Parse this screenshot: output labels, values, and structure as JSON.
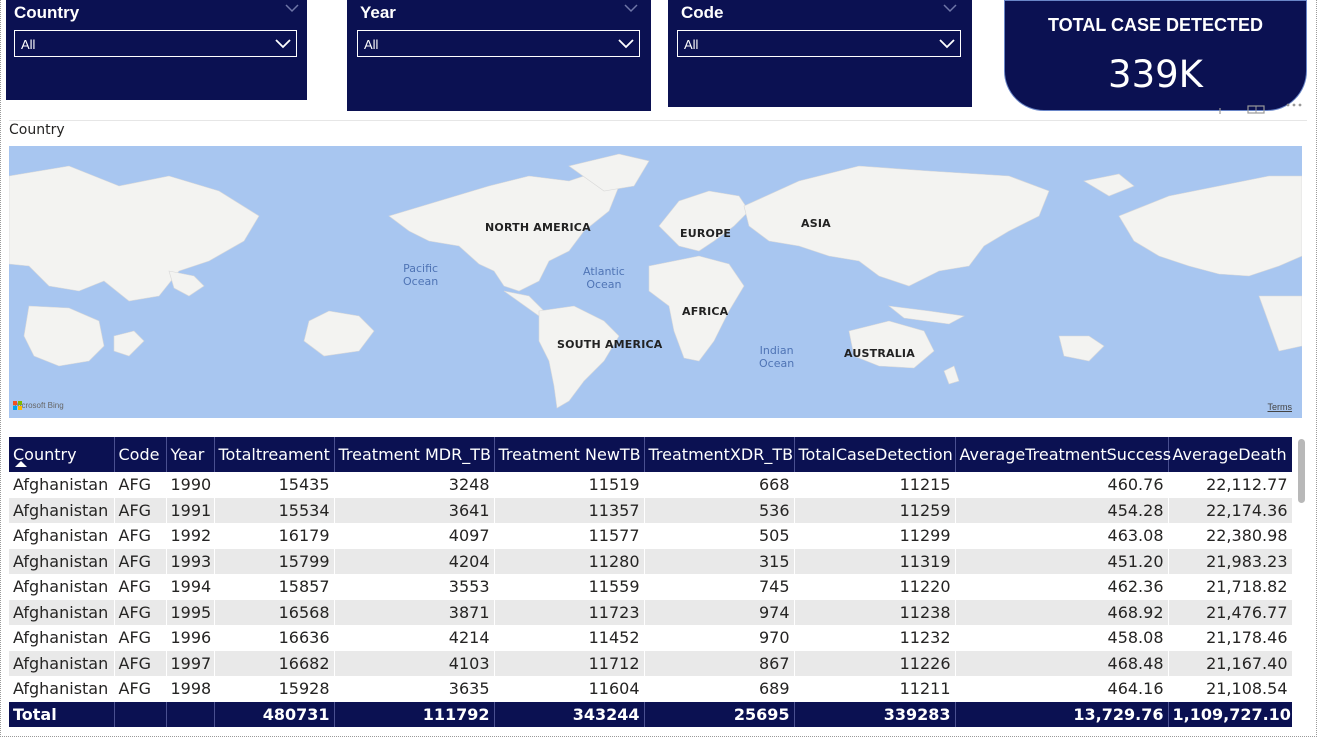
{
  "slicers": [
    {
      "title": "Country",
      "value": "All"
    },
    {
      "title": "Year",
      "value": "All"
    },
    {
      "title": "Code",
      "value": "All"
    }
  ],
  "kpi": {
    "title": "TOTAL CASE DETECTED",
    "value": "339K"
  },
  "map": {
    "title": "Country",
    "continents": [
      "NORTH AMERICA",
      "EUROPE",
      "ASIA",
      "AFRICA",
      "SOUTH AMERICA",
      "AUSTRALIA"
    ],
    "oceans": [
      "Pacific\nOcean",
      "Atlantic\nOcean",
      "Indian\nOcean"
    ],
    "attribution": "Microsoft Bing",
    "terms": "Terms"
  },
  "table": {
    "columns": [
      "Country",
      "Code",
      "Year",
      "Totaltreament",
      "Treatment MDR_TB",
      "Treatment NewTB",
      "TreatmentXDR_TB",
      "TotalCaseDetection",
      "AverageTreatmentSuccess",
      "AverageDeath"
    ],
    "rows": [
      [
        "Afghanistan",
        "AFG",
        "1990",
        "15435",
        "3248",
        "11519",
        "668",
        "11215",
        "460.76",
        "22,112.77"
      ],
      [
        "Afghanistan",
        "AFG",
        "1991",
        "15534",
        "3641",
        "11357",
        "536",
        "11259",
        "454.28",
        "22,174.36"
      ],
      [
        "Afghanistan",
        "AFG",
        "1992",
        "16179",
        "4097",
        "11577",
        "505",
        "11299",
        "463.08",
        "22,380.98"
      ],
      [
        "Afghanistan",
        "AFG",
        "1993",
        "15799",
        "4204",
        "11280",
        "315",
        "11319",
        "451.20",
        "21,983.23"
      ],
      [
        "Afghanistan",
        "AFG",
        "1994",
        "15857",
        "3553",
        "11559",
        "745",
        "11220",
        "462.36",
        "21,718.82"
      ],
      [
        "Afghanistan",
        "AFG",
        "1995",
        "16568",
        "3871",
        "11723",
        "974",
        "11238",
        "468.92",
        "21,476.77"
      ],
      [
        "Afghanistan",
        "AFG",
        "1996",
        "16636",
        "4214",
        "11452",
        "970",
        "11232",
        "458.08",
        "21,178.46"
      ],
      [
        "Afghanistan",
        "AFG",
        "1997",
        "16682",
        "4103",
        "11712",
        "867",
        "11226",
        "468.48",
        "21,167.40"
      ],
      [
        "Afghanistan",
        "AFG",
        "1998",
        "15928",
        "3635",
        "11604",
        "689",
        "11211",
        "464.16",
        "21,108.54"
      ]
    ],
    "total": [
      "Total",
      "",
      "",
      "480731",
      "111792",
      "343244",
      "25695",
      "339283",
      "13,729.76",
      "1,109,727.10"
    ]
  },
  "colors": {
    "navy": "#0b1152",
    "ocean": "#a8c6f0",
    "land": "#f4f4f2",
    "row_alt": "#e9e9e9"
  }
}
